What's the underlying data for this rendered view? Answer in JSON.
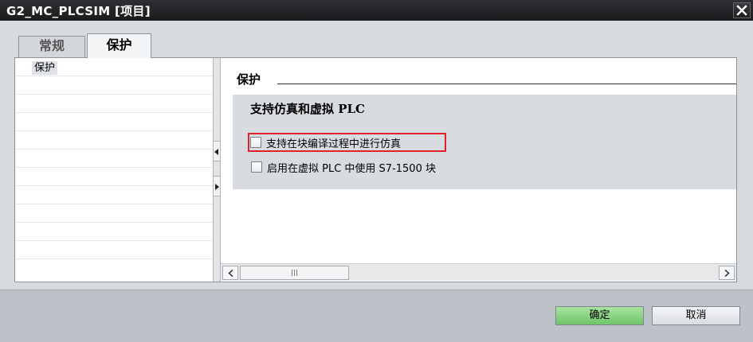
{
  "window": {
    "title": "G2_MC_PLCSIM [项目]"
  },
  "tabs": [
    {
      "label": "常规",
      "active": false
    },
    {
      "label": "保护",
      "active": true
    }
  ],
  "nav": {
    "items": [
      {
        "label": "保护",
        "selected": true
      }
    ]
  },
  "content": {
    "section_title": "保护",
    "group_title": "支持仿真和虚拟 PLC",
    "options": [
      {
        "label": "支持在块编译过程中进行仿真",
        "checked": false,
        "highlighted": true
      },
      {
        "label": "启用在虚拟 PLC 中使用 S7-1500 块",
        "checked": false,
        "highlighted": false
      }
    ]
  },
  "footer": {
    "ok_label": "确定",
    "cancel_label": "取消"
  },
  "colors": {
    "highlight_border": "#e0202a",
    "ok_button": "#7fcf78"
  },
  "icons": {
    "close": "close-icon",
    "splitter_left": "triangle-left-icon",
    "splitter_right": "triangle-right-icon",
    "scroll_left": "chevron-left-icon",
    "scroll_right": "chevron-right-icon"
  }
}
